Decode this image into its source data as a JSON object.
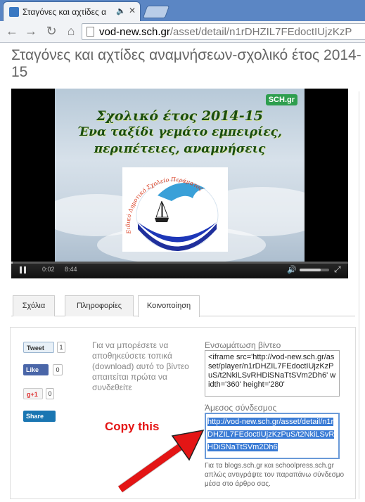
{
  "browser": {
    "tab_title": "Σταγόνες και αχτίδες α",
    "url_prefix": "vod-new.sch.gr",
    "url_path": "/asset/detail/n1rDHZIL7FEdoctIUjzKzP"
  },
  "page": {
    "title": "Σταγόνες και αχτίδες αναμνήσεων-σχολικό έτος 2014-15"
  },
  "video": {
    "badge": "SCH.gr",
    "line1": "Σχολικό έτος 2014-15",
    "line2": "Ένα ταξίδι γεμάτο εμπειρίες,",
    "line3": "περιπέτειες, αναμνήσεις",
    "logo_text": "Ειδικό Δημοτικό Σχολείο Περάματος",
    "time_current": "0:02",
    "time_total": "8:44",
    "progress": 0.004
  },
  "tabs": {
    "items": [
      {
        "label": "Σχόλια"
      },
      {
        "label": "Πληροφορίες"
      },
      {
        "label": "Κοινοποίηση"
      }
    ],
    "active": "Κοινοποίηση"
  },
  "share": {
    "tweet_label": "Tweet",
    "tweet_count": "1",
    "like_label": "Like",
    "like_count": "0",
    "gplus_label": "g+1",
    "gplus_count": "0",
    "linkedin_label": "Share",
    "download_note": "Για να μπορέσετε να αποθηκεύσετε τοπικά (download) αυτό το βίντεο απαιτείται πρώτα να συνδεθείτε",
    "embed_label": "Ενσωμάτωση βίντεο",
    "embed_code": "<iframe src='http://vod-new.sch.gr/asset/player/n1rDHZIL7FEdoctIUjzKzPuS/t2NkiLSvRHDiSNaTtSVm2Dh6' width='360' height='280'",
    "direct_label": "Άμεσος σύνδεσμος",
    "direct_link": "http://vod-new.sch.gr/asset/detail/n1rDHZIL7FEdoctIUjzKzPuS/t2NkiLSvRHDiSNaTtSVm2Dh6",
    "blog_note": "Για τα blogs.sch.gr και schoolpress.sch.gr απλώς αντιγράψτε τον παραπάνω σύνδεσμο μέσα στο άρθρο σας."
  },
  "annotation": {
    "copy_text": "Copy this",
    "color": "#e41515"
  }
}
